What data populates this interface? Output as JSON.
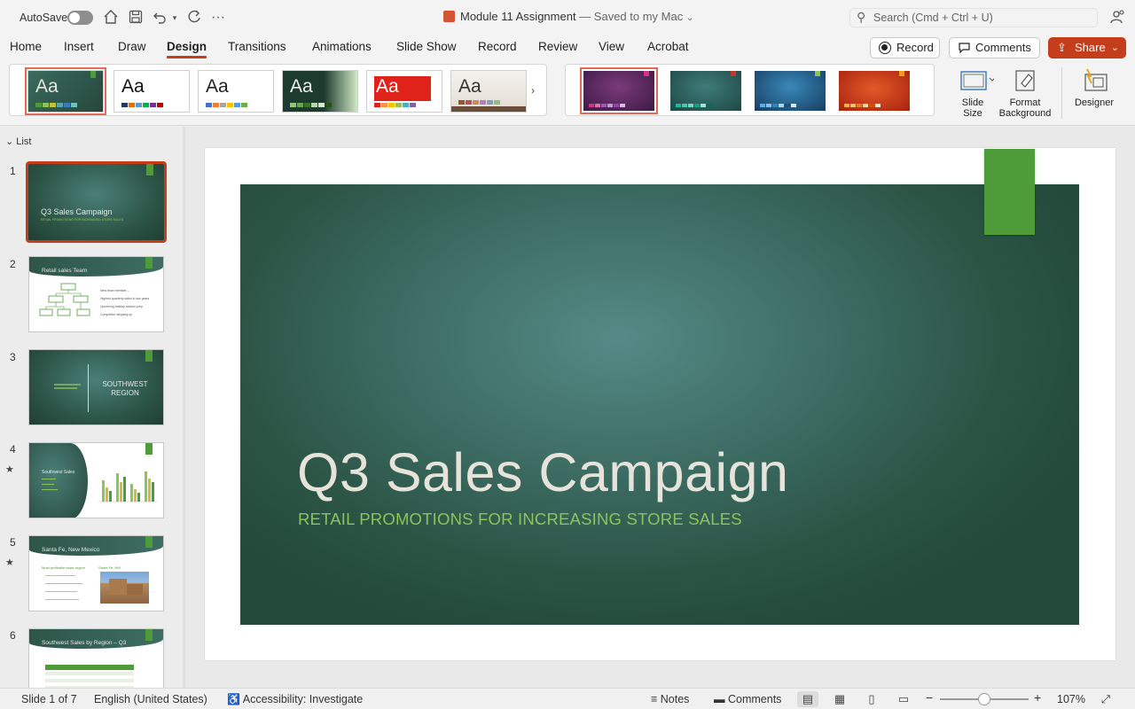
{
  "titlebar": {
    "autosave_label": "AutoSave",
    "doc_name": "Module 11 Assignment",
    "saved_status": "— Saved to my Mac",
    "search_placeholder": "Search (Cmd + Ctrl + U)"
  },
  "tabs": [
    "Home",
    "Insert",
    "Draw",
    "Design",
    "Transitions",
    "Animations",
    "Slide Show",
    "Record",
    "Review",
    "View",
    "Acrobat"
  ],
  "active_tab": "Design",
  "actions": {
    "record": "Record",
    "comments": "Comments",
    "share": "Share"
  },
  "ribbon": {
    "theme_sample": "Aa",
    "slide_size": "Slide Size",
    "slide_size_l1": "Slide",
    "slide_size_l2": "Size",
    "format_bg_l1": "Format",
    "format_bg_l2": "Background",
    "designer": "Designer"
  },
  "panel": {
    "header": "List",
    "slides": [
      {
        "num": "1",
        "title": "Q3 Sales Campaign",
        "subtitle": "RETAIL PROMOTIONS FOR INCREASING STORE SALES"
      },
      {
        "num": "2",
        "title": "Retail sales Team",
        "bullets": [
          "New team member –",
          "Highest quarterly sales in two years",
          "Upcoming holiday season prep",
          "Competitor stepping up"
        ]
      },
      {
        "num": "3",
        "title": "SOUTHWEST REGION"
      },
      {
        "num": "4",
        "title": "Southwest Sales",
        "star": "★"
      },
      {
        "num": "5",
        "title": "Santa Fe, New Mexico",
        "star": "★",
        "heading": "Most profitable sales region",
        "photo_caption": "Santa Fe, NM"
      },
      {
        "num": "6",
        "title": "Southwest Sales by Region – Q3"
      }
    ]
  },
  "slide": {
    "title": "Q3 Sales Campaign",
    "subtitle": "RETAIL PROMOTIONS FOR INCREASING STORE SALES"
  },
  "status": {
    "slide_pos": "Slide 1 of 7",
    "language": "English (United States)",
    "accessibility": "Accessibility: Investigate",
    "notes": "Notes",
    "comments": "Comments",
    "zoom": "107%"
  },
  "colors": {
    "accent": "#c43e1c",
    "slide_green": "#2c5546",
    "flag_green": "#4e9b3a",
    "subtitle_green": "#8dc35b"
  }
}
